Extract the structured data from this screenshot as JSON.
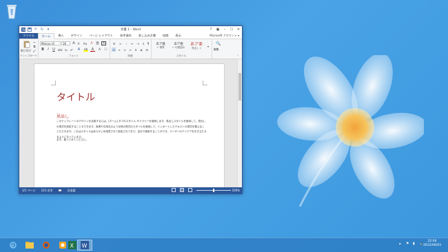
{
  "window": {
    "title": "文書 1 - Word",
    "help": "?",
    "account": "Microsoft アカウント ▾"
  },
  "tabs": [
    {
      "label": "ファイル"
    },
    {
      "label": "ホーム"
    },
    {
      "label": "挿入"
    },
    {
      "label": "デザイン"
    },
    {
      "label": "ページ レイアウト"
    },
    {
      "label": "参考資料"
    },
    {
      "label": "差し込み文書"
    },
    {
      "label": "校閲"
    },
    {
      "label": "表示"
    }
  ],
  "ribbon": {
    "clipboard": {
      "paste_label": "貼り付け",
      "group_label": "クリップボード"
    },
    "font": {
      "font_name": "Meiryo UI",
      "font_size": "36",
      "group_label": "フォント",
      "bold": "B",
      "italic": "I",
      "underline": "U",
      "grow": "A",
      "shrink": "A",
      "case": "Aa",
      "clear": "A"
    },
    "paragraph": {
      "group_label": "段落"
    },
    "styles": {
      "group_label": "スタイル",
      "items": [
        {
          "sample": "あア亜",
          "name": "↵ 標準"
        },
        {
          "sample": "あア亜",
          "name": "↵ 行間詰め"
        },
        {
          "sample": "あア亜",
          "name": "見出し 1"
        }
      ]
    },
    "editing": {
      "label": "編集"
    }
  },
  "document": {
    "title": "タイトル",
    "heading": "見出し",
    "body": "このテンプレートのデザインを活用するには、[ホーム] タブのスタイル ギャラリーを使用します。見出しスタイルを使用して、見出しの書式を設定することもできます。後書や引用文のような他の書式のスタイルを使用して、インポートしたテキストの書式を整えることもできます。これはスタイルはあらかじめ用意されて設定されており、自分で使用することができ、ユーザーのアイデアを引き立たせるようになっています。",
    "body2": "まず、使ってみてください。"
  },
  "status": {
    "page": "1/1 ページ",
    "words": "123 文字",
    "language": "日本語",
    "zoom": "100%"
  },
  "clock": {
    "time": "22:04",
    "date": "2012/06/03"
  }
}
